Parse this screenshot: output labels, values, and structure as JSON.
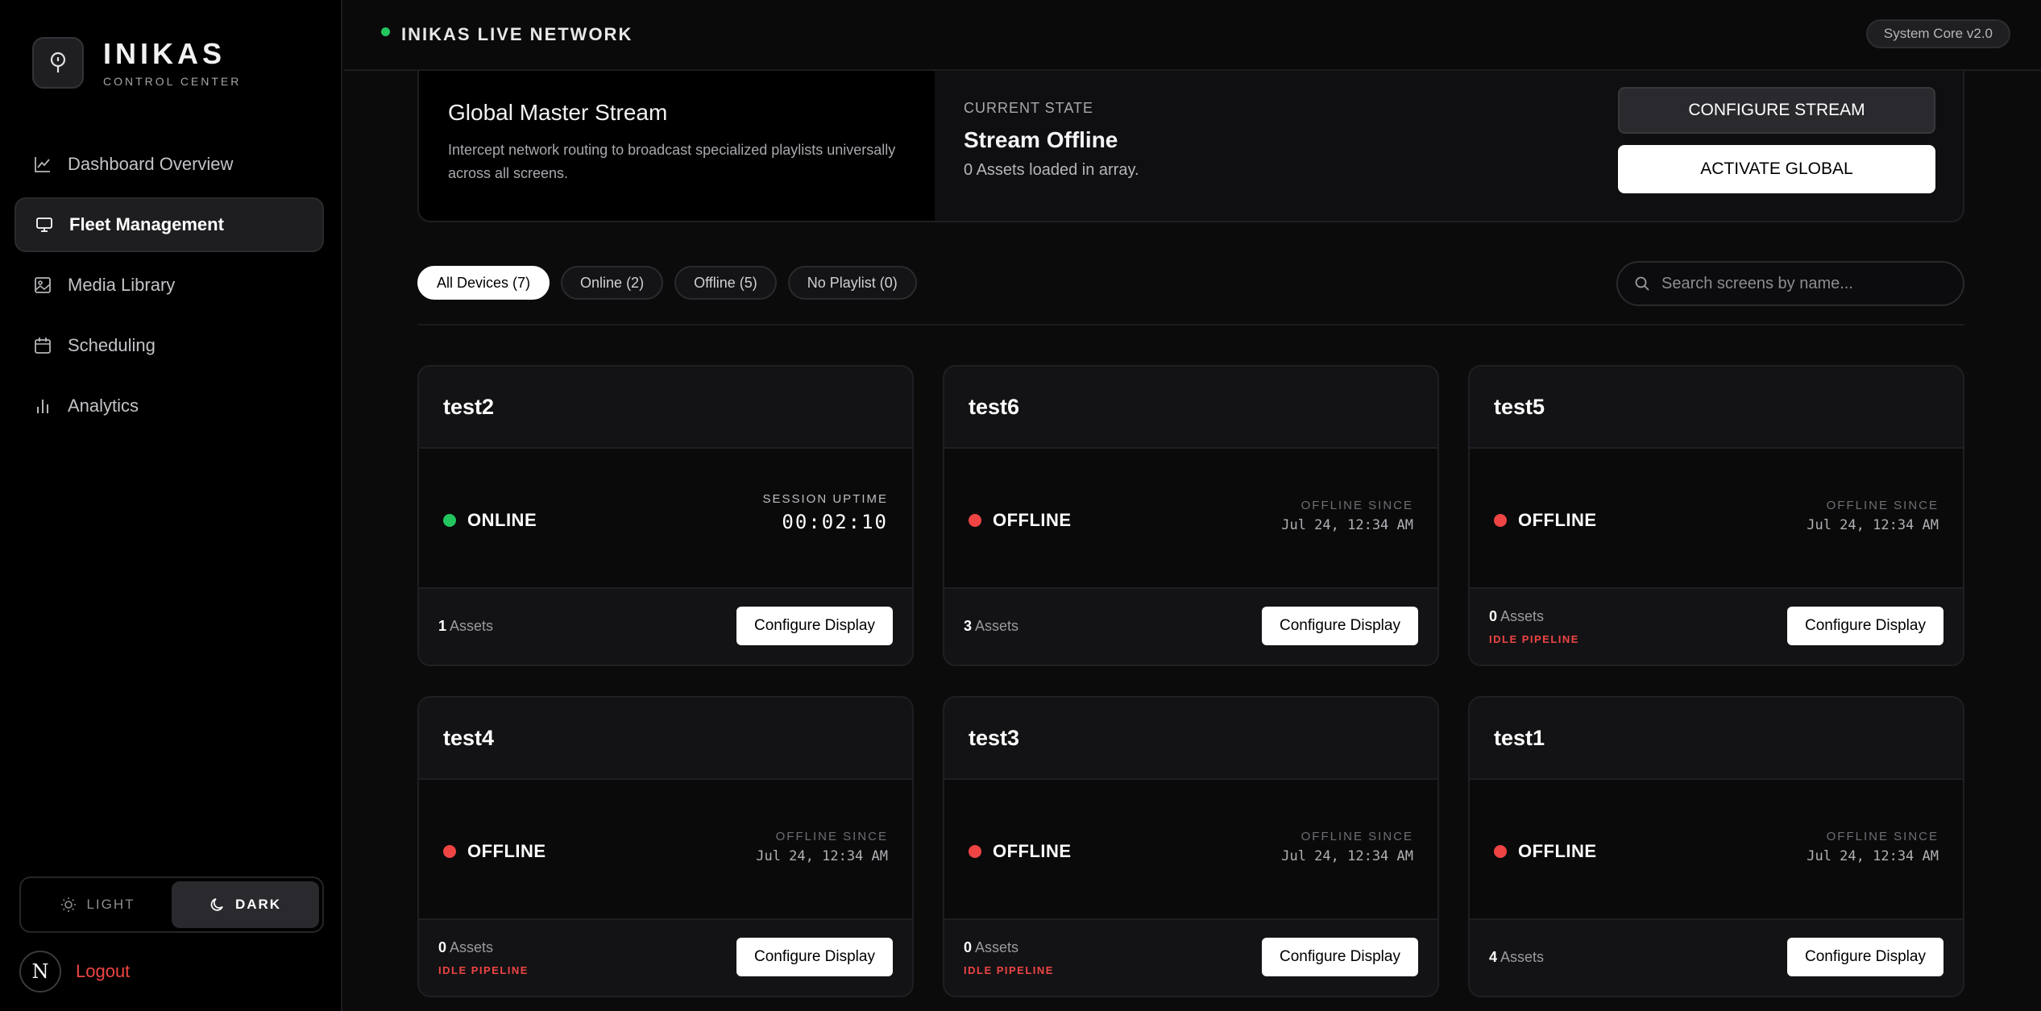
{
  "brand": {
    "title": "INIKAS",
    "subtitle": "CONTROL CENTER"
  },
  "nav": [
    {
      "label": "Dashboard Overview",
      "icon": "chart-line-icon",
      "active": false
    },
    {
      "label": "Fleet Management",
      "icon": "monitor-icon",
      "active": true
    },
    {
      "label": "Media Library",
      "icon": "image-icon",
      "active": false
    },
    {
      "label": "Scheduling",
      "icon": "calendar-icon",
      "active": false
    },
    {
      "label": "Analytics",
      "icon": "bar-chart-icon",
      "active": false
    }
  ],
  "theme": {
    "light_label": "LIGHT",
    "dark_label": "DARK",
    "selected": "dark"
  },
  "user": {
    "avatar_letter": "N",
    "logout_label": "Logout"
  },
  "topbar": {
    "network_label": "INIKAS LIVE NETWORK",
    "version": "System Core v2.0"
  },
  "global_stream": {
    "title": "Global Master Stream",
    "description": "Intercept network routing to broadcast specialized playlists universally across all screens.",
    "state_label": "CURRENT STATE",
    "state_value": "Stream Offline",
    "state_sub": "0 Assets loaded in array.",
    "configure_label": "CONFIGURE STREAM",
    "activate_label": "ACTIVATE GLOBAL"
  },
  "filters": [
    {
      "label": "All Devices (7)",
      "active": true
    },
    {
      "label": "Online (2)",
      "active": false
    },
    {
      "label": "Offline (5)",
      "active": false
    },
    {
      "label": "No Playlist (0)",
      "active": false
    }
  ],
  "search": {
    "placeholder": "Search screens by name..."
  },
  "devices": [
    {
      "name": "test2",
      "status": "ONLINE",
      "online": true,
      "meta_label": "SESSION UPTIME",
      "meta_value": "00:02:10",
      "assets_count": "1",
      "assets_label": "Assets",
      "idle": false,
      "button": "Configure Display"
    },
    {
      "name": "test6",
      "status": "OFFLINE",
      "online": false,
      "meta_label": "OFFLINE SINCE",
      "meta_value": "Jul 24, 12:34 AM",
      "assets_count": "3",
      "assets_label": "Assets",
      "idle": false,
      "button": "Configure Display"
    },
    {
      "name": "test5",
      "status": "OFFLINE",
      "online": false,
      "meta_label": "OFFLINE SINCE",
      "meta_value": "Jul 24, 12:34 AM",
      "assets_count": "0",
      "assets_label": "Assets",
      "idle": true,
      "idle_label": "IDLE PIPELINE",
      "button": "Configure Display"
    },
    {
      "name": "test4",
      "status": "OFFLINE",
      "online": false,
      "meta_label": "OFFLINE SINCE",
      "meta_value": "Jul 24, 12:34 AM",
      "assets_count": "0",
      "assets_label": "Assets",
      "idle": true,
      "idle_label": "IDLE PIPELINE",
      "button": "Configure Display"
    },
    {
      "name": "test3",
      "status": "OFFLINE",
      "online": false,
      "meta_label": "OFFLINE SINCE",
      "meta_value": "Jul 24, 12:34 AM",
      "assets_count": "0",
      "assets_label": "Assets",
      "idle": true,
      "idle_label": "IDLE PIPELINE",
      "button": "Configure Display"
    },
    {
      "name": "test1",
      "status": "OFFLINE",
      "online": false,
      "meta_label": "OFFLINE SINCE",
      "meta_value": "Jul 24, 12:34 AM",
      "assets_count": "4",
      "assets_label": "Assets",
      "idle": false,
      "button": "Configure Display"
    }
  ],
  "colors": {
    "online": "#22c55e",
    "offline": "#ef4444",
    "accent": "#ffffff",
    "background": "#0b0b0c"
  }
}
